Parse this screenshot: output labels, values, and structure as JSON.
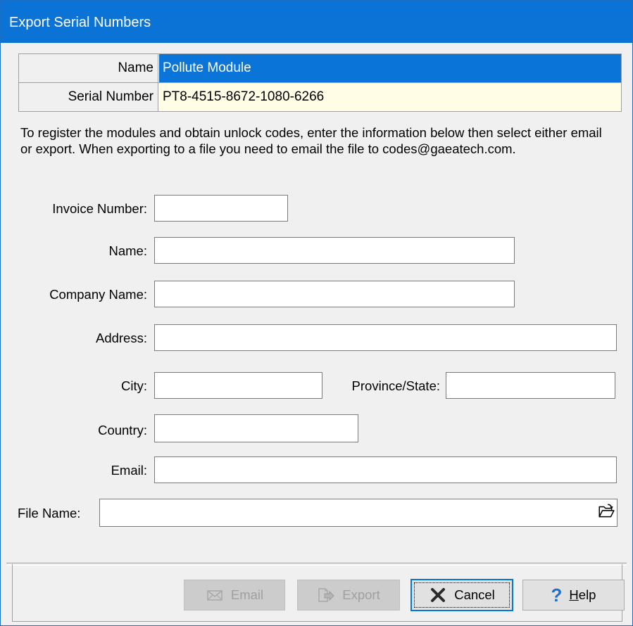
{
  "window": {
    "title": "Export Serial Numbers"
  },
  "grid": {
    "rows": [
      {
        "label": "Name",
        "value": "Pollute Module"
      },
      {
        "label": "Serial Number",
        "value": "PT8-4515-8672-1080-6266"
      }
    ]
  },
  "info_text": "To register the modules and obtain unlock codes, enter the information below then select either email or export. When exporting to a file you need to email the file to codes@gaeatech.com.",
  "form": {
    "invoice_label": "Invoice Number:",
    "invoice_value": "",
    "name_label": "Name:",
    "name_value": "",
    "company_label": "Company Name:",
    "company_value": "",
    "address_label": "Address:",
    "address_value": "",
    "city_label": "City:",
    "city_value": "",
    "province_label": "Province/State:",
    "province_value": "",
    "country_label": "Country:",
    "country_value": "",
    "email_label": "Email:",
    "email_value": "",
    "file_label": "File Name:",
    "file_value": ""
  },
  "buttons": {
    "email": "Email",
    "export": "Export",
    "cancel": "Cancel",
    "help_rest": "elp",
    "help_mnemonic": "H"
  },
  "icons": {
    "browse": "folder-open-icon",
    "email": "envelope-icon",
    "export": "export-icon",
    "cancel": "x-icon",
    "help": "question-icon"
  },
  "colors": {
    "titlebar": "#0b73d6",
    "selected_row": "#0a74d8",
    "serial_row": "#fffde6",
    "default_button_border": "#0078d7"
  }
}
